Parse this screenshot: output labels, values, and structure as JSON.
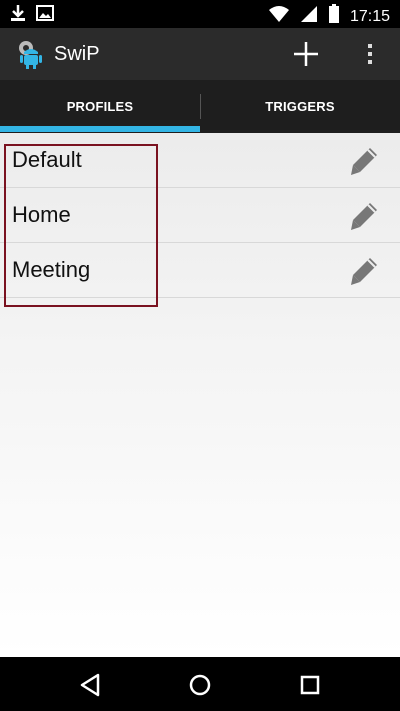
{
  "status_bar": {
    "time": "17:15",
    "icons": [
      "download-icon",
      "image-icon",
      "wifi-icon",
      "signal-icon",
      "battery-icon"
    ]
  },
  "app_bar": {
    "title": "SwiP",
    "icon": "android-gear-icon",
    "actions": [
      "plus-icon",
      "overflow-menu-icon"
    ]
  },
  "tabs": [
    {
      "label": "PROFILES",
      "selected": true
    },
    {
      "label": "TRIGGERS",
      "selected": false
    }
  ],
  "profiles": [
    {
      "name": "Default"
    },
    {
      "name": "Home"
    },
    {
      "name": "Meeting"
    }
  ],
  "colors": {
    "accent": "#33b5e5",
    "highlight_border": "#7a1220"
  },
  "nav_bar": [
    "back-icon",
    "home-icon",
    "recents-icon"
  ]
}
